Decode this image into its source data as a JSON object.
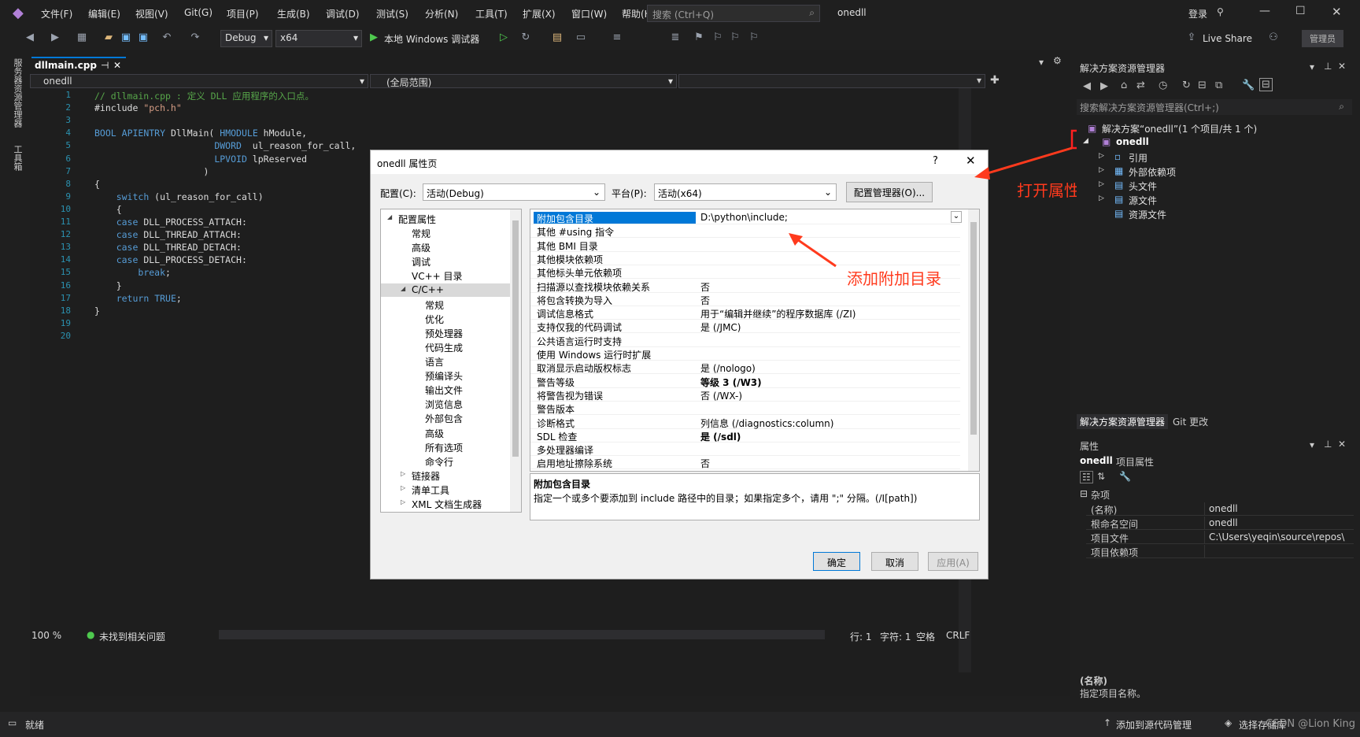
{
  "menu": [
    "文件(F)",
    "编辑(E)",
    "视图(V)",
    "Git(G)",
    "项目(P)",
    "生成(B)",
    "调试(D)",
    "测试(S)",
    "分析(N)",
    "工具(T)",
    "扩展(X)",
    "窗口(W)",
    "帮助(H)"
  ],
  "search_placeholder": "搜索 (Ctrl+Q)",
  "solution_title": "onedll",
  "login": "登录",
  "live_share": "Live Share",
  "admin": "管理员",
  "toolbar": {
    "config": "Debug",
    "platform": "x64",
    "debugger": "本地 Windows 调试器"
  },
  "left_strip": [
    "服务器资源管理器",
    "工具箱"
  ],
  "editor": {
    "tab": "dllmain.cpp",
    "nav_left": "onedll",
    "nav_mid": "(全局范围)",
    "lines": [
      "// dllmain.cpp : 定义 DLL 应用程序的入口点。",
      "#include \"pch.h\"",
      "",
      "BOOL APIENTRY DllMain( HMODULE hModule,",
      "                      DWORD  ul_reason_for_call,",
      "                      LPVOID lpReserved",
      "                    )",
      "{",
      "    switch (ul_reason_for_call)",
      "    {",
      "    case DLL_PROCESS_ATTACH:",
      "    case DLL_THREAD_ATTACH:",
      "    case DLL_THREAD_DETACH:",
      "    case DLL_PROCESS_DETACH:",
      "        break;",
      "    }",
      "    return TRUE;",
      "}",
      "",
      ""
    ],
    "zoom": "100 %",
    "issues": "未找到相关问题",
    "pos_line": "行: 1",
    "pos_char": "字符: 1",
    "space": "空格",
    "crlf": "CRLF"
  },
  "dialog": {
    "title": "onedll 属性页",
    "help": "?",
    "config_label": "配置(C):",
    "config_value": "活动(Debug)",
    "platform_label": "平台(P):",
    "platform_value": "活动(x64)",
    "config_mgr": "配置管理器(O)...",
    "tree": [
      {
        "label": "配置属性",
        "indent": 0,
        "arrow": "◢"
      },
      {
        "label": "常规",
        "indent": 1
      },
      {
        "label": "高级",
        "indent": 1
      },
      {
        "label": "调试",
        "indent": 1
      },
      {
        "label": "VC++ 目录",
        "indent": 1
      },
      {
        "label": "C/C++",
        "indent": 1,
        "arrow": "◢",
        "selected": true
      },
      {
        "label": "常规",
        "indent": 2
      },
      {
        "label": "优化",
        "indent": 2
      },
      {
        "label": "预处理器",
        "indent": 2
      },
      {
        "label": "代码生成",
        "indent": 2
      },
      {
        "label": "语言",
        "indent": 2
      },
      {
        "label": "预编译头",
        "indent": 2
      },
      {
        "label": "输出文件",
        "indent": 2
      },
      {
        "label": "浏览信息",
        "indent": 2
      },
      {
        "label": "外部包含",
        "indent": 2
      },
      {
        "label": "高级",
        "indent": 2
      },
      {
        "label": "所有选项",
        "indent": 2
      },
      {
        "label": "命令行",
        "indent": 2
      },
      {
        "label": "链接器",
        "indent": 1,
        "arrow": "▷"
      },
      {
        "label": "清单工具",
        "indent": 1,
        "arrow": "▷"
      },
      {
        "label": "XML 文档生成器",
        "indent": 1,
        "arrow": "▷"
      }
    ],
    "props": [
      {
        "name": "附加包含目录",
        "value": "D:\\python\\include;",
        "selected": true
      },
      {
        "name": "其他 #using 指令",
        "value": ""
      },
      {
        "name": "其他 BMI 目录",
        "value": ""
      },
      {
        "name": "其他模块依赖项",
        "value": ""
      },
      {
        "name": "其他标头单元依赖项",
        "value": ""
      },
      {
        "name": "扫描源以查找模块依赖关系",
        "value": "否"
      },
      {
        "name": "将包含转换为导入",
        "value": "否"
      },
      {
        "name": "调试信息格式",
        "value": "用于“编辑并继续”的程序数据库 (/ZI)"
      },
      {
        "name": "支持仅我的代码调试",
        "value": "是 (/JMC)"
      },
      {
        "name": "公共语言运行时支持",
        "value": ""
      },
      {
        "name": "使用 Windows 运行时扩展",
        "value": ""
      },
      {
        "name": "取消显示启动版权标志",
        "value": "是 (/nologo)"
      },
      {
        "name": "警告等级",
        "value": "等级 3 (/W3)",
        "bold": true
      },
      {
        "name": "将警告视为错误",
        "value": "否 (/WX-)"
      },
      {
        "name": "警告版本",
        "value": ""
      },
      {
        "name": "诊断格式",
        "value": "列信息 (/diagnostics:column)"
      },
      {
        "name": "SDL 检查",
        "value": "是 (/sdl)",
        "bold": true
      },
      {
        "name": "多处理器编译",
        "value": ""
      },
      {
        "name": "启用地址擦除系统",
        "value": "否"
      }
    ],
    "desc_title": "附加包含目录",
    "desc_text": "指定一个或多个要添加到 include 路径中的目录；如果指定多个，请用 \";\" 分隔。(/I[path])",
    "ok": "确定",
    "cancel": "取消",
    "apply": "应用(A)"
  },
  "annotations": {
    "open_props": "打开属性",
    "add_dir": "添加附加目录"
  },
  "solexp": {
    "title": "解决方案资源管理器",
    "search": "搜索解决方案资源管理器(Ctrl+;)",
    "solution": "解决方案“onedll”(1 个项目/共 1 个)",
    "project": "onedll",
    "items": [
      "引用",
      "外部依赖项",
      "头文件",
      "源文件",
      "资源文件"
    ],
    "tab1": "解决方案资源管理器",
    "tab2": "Git 更改"
  },
  "properties": {
    "title": "属性",
    "object": "onedll",
    "object_type": "项目属性",
    "category": "杂项",
    "rows": [
      {
        "name": "(名称)",
        "value": "onedll"
      },
      {
        "name": "根命名空间",
        "value": "onedll"
      },
      {
        "name": "项目文件",
        "value": "C:\\Users\\yeqin\\source\\repos\\"
      },
      {
        "name": "项目依赖项",
        "value": ""
      }
    ],
    "desc_title": "(名称)",
    "desc_text": "指定项目名称。"
  },
  "status": {
    "ready": "就绪",
    "add_source": "添加到源代码管理",
    "select_repo": "选择存储库",
    "watermark": "CSDN @Lion King"
  },
  "colors": {
    "accent": "#0078d7",
    "keyword": "#569cd6",
    "comment": "#57a64a",
    "string": "#d69d85",
    "annotation": "#ff3a1d"
  }
}
